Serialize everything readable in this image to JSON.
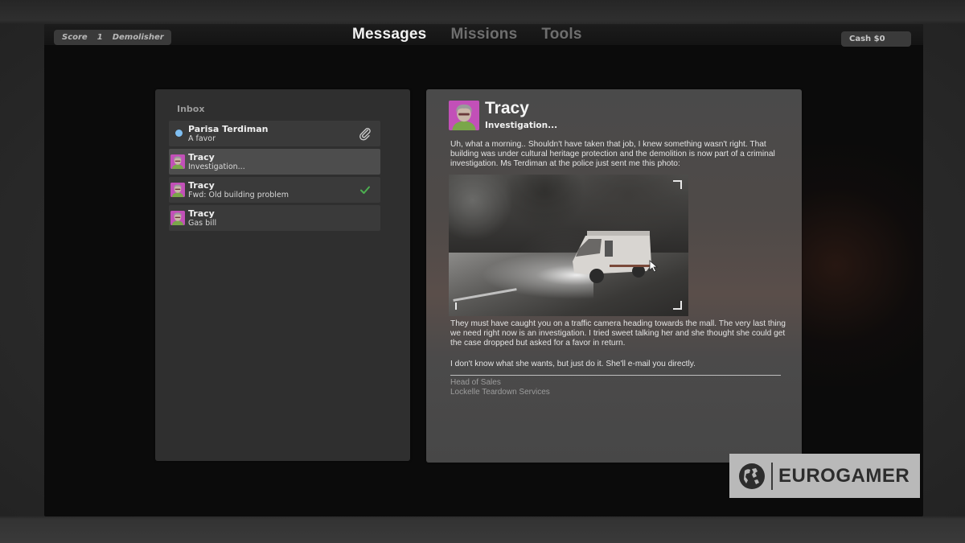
{
  "header": {
    "score_label": "Score",
    "score_value": "1",
    "rank": "Demolisher",
    "cash": "Cash $0",
    "tabs": [
      {
        "label": "Messages",
        "active": true
      },
      {
        "label": "Missions",
        "active": false
      },
      {
        "label": "Tools",
        "active": false
      }
    ]
  },
  "inbox": {
    "title": "Inbox",
    "items": [
      {
        "sender": "Parisa Terdiman",
        "subject": "A favor",
        "unread": true,
        "icon": "paperclip-icon",
        "selected": false
      },
      {
        "sender": "Tracy",
        "subject": "Investigation...",
        "unread": false,
        "icon": "",
        "selected": true
      },
      {
        "sender": "Tracy",
        "subject": "Fwd: Old building problem",
        "unread": false,
        "icon": "checkmark-icon",
        "selected": false
      },
      {
        "sender": "Tracy",
        "subject": "Gas bill",
        "unread": false,
        "icon": "",
        "selected": false
      }
    ]
  },
  "message": {
    "from": "Tracy",
    "subject": "Investigation...",
    "body_1": "Uh, what a morning.. Shouldn't have taken that job, I knew something wasn't right. That building was under cultural heritage protection and the demolition is now part of a criminal investigation. Ms Terdiman at the police just sent me this photo:",
    "photo_alt": "traffic-camera-photo-of-van",
    "body_2": "They must have caught you on a traffic camera heading towards the mall. The very last thing we need right now is an investigation. I tried sweet talking her and she thought she could get the case dropped but asked for a favor in return.",
    "body_3": "I don't know what she wants, but just do it. She'll e-mail you directly.",
    "signature_line1": "Head of Sales",
    "signature_line2": "Lockelle Teardown Services"
  },
  "watermark": {
    "text": "EUROGAMER"
  },
  "colors": {
    "unread_dot": "#7fbff2",
    "checkmark": "#4caf50",
    "avatar_bg": "#c250b8",
    "active_tab": "#f2f2f2",
    "inactive_tab": "#6e6e6e"
  }
}
